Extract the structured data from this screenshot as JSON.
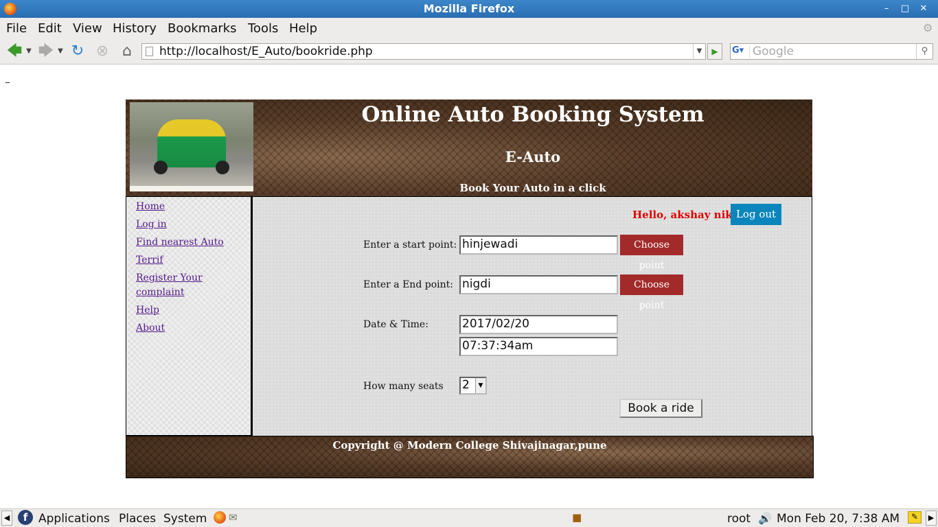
{
  "window": {
    "title": "Mozilla Firefox"
  },
  "menu": [
    "File",
    "Edit",
    "View",
    "History",
    "Bookmarks",
    "Tools",
    "Help"
  ],
  "nav": {
    "url": "http://localhost/E_Auto/bookride.php",
    "search_placeholder": "Google"
  },
  "page": {
    "cursor_mark": "_",
    "site_title": "Online Auto Booking System",
    "site_subtitle": "E-Auto",
    "site_tagline": "Book Your Auto in a click",
    "sidebar": [
      "Home",
      "Log in",
      "Find nearest Auto",
      "Terrif",
      "Register Your complaint",
      "Help",
      "About"
    ],
    "greeting": "Hello, akshay nikam",
    "logout_label": "Log out",
    "form": {
      "start_label": "Enter a start point:",
      "start_value": "hinjewadi",
      "end_label": "Enter a End point:",
      "end_value": "nigdi",
      "choose_label": "Choose point",
      "datetime_label": "Date & Time:",
      "date_value": "2017/02/20",
      "time_value": "07:37:34am",
      "seats_label": "How many seats",
      "seats_value": "2",
      "book_label": "Book a ride"
    },
    "footer": "Copyright @ Modern College Shivajinagar,pune"
  },
  "taskbar": {
    "applications": "Applications",
    "places": "Places",
    "system": "System",
    "user": "root",
    "clock": "Mon Feb 20,  7:38 AM"
  }
}
